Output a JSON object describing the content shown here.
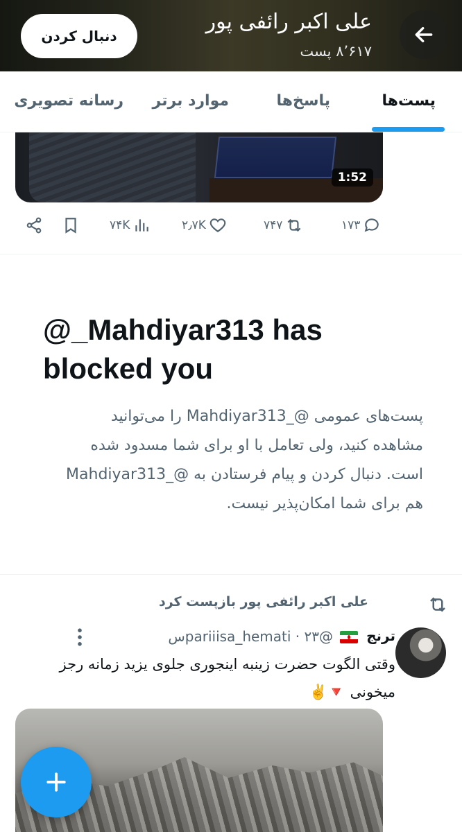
{
  "header": {
    "title": "علی اکبر رائفی پور",
    "post_count": "۸٬۶۱۷ پست",
    "follow_label": "دنبال کردن"
  },
  "tabs": [
    {
      "label": "پست‌ها",
      "active": true
    },
    {
      "label": "پاسخ‌ها",
      "active": false
    },
    {
      "label": "موارد برتر",
      "active": false
    },
    {
      "label": "رسانه تصویری",
      "active": false
    }
  ],
  "video_post": {
    "duration": "1:52",
    "stats": {
      "replies": "۱۷۳",
      "reposts": "۷۴۷",
      "likes": "۲٫۷K",
      "views": "۷۴K"
    }
  },
  "blocked": {
    "title": "@_Mahdiyar313 has blocked you",
    "body": "پست‌های عمومی @_Mahdiyar313 را می‌توانید مشاهده کنید، ولی تعامل با او برای شما مسدود شده است. دنبال کردن و پیام فرستادن به @_Mahdiyar313 هم برای شما امکان‌پذیر نیست."
  },
  "retweet": {
    "label": "علی اکبر رائفی پور بازپست کرد",
    "author_name": "ترنج",
    "handle": "@pariiisa_hemati",
    "time": "۲۳س",
    "text": "وقتی الگوت حضرت زینبه اینجوری جلوی یزید زمانه رجز میخونی 🔻✌️"
  },
  "colors": {
    "accent": "#1d9bf0",
    "secondary_text": "#536471",
    "primary_text": "#0f1419"
  }
}
